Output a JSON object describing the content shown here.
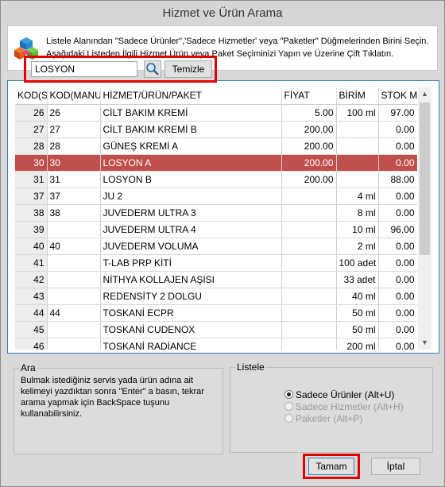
{
  "window": {
    "title": "Hizmet ve Ürün Arama"
  },
  "header": {
    "line1": "Listele Alanından \"Sadece Ürünler\",'Sadece Hizmetler' veya \"Paketler\" Düğmelerinden Birini Seçin.",
    "line2": "Aşağıdaki Listeden İlgili Hizmet,Ürün veya Paket Seçiminizi Yapın ve Üzerine Çift Tıklatın."
  },
  "grid": {
    "columns": [
      "KOD(S",
      "KOD(MANUE",
      "HİZMET/ÜRÜN/PAKET",
      "FİYAT",
      "BİRİM",
      "STOK Mİ"
    ],
    "rows": [
      [
        "26",
        "26",
        "CİLT BAKIM KREMİ",
        "5.00",
        "100 ml",
        "97.00"
      ],
      [
        "27",
        "27",
        "CİLT BAKIM KREMİ B",
        "200.00",
        "",
        "0.00"
      ],
      [
        "28",
        "28",
        "GÜNEŞ KREMİ A",
        "200.00",
        "",
        "0.00"
      ],
      [
        "30",
        "30",
        "LOSYON A",
        "200.00",
        "",
        "0.00"
      ],
      [
        "31",
        "31",
        "LOSYON B",
        "200.00",
        "",
        "88.00"
      ],
      [
        "37",
        "37",
        "JU 2",
        "",
        "4 ml",
        "0.00"
      ],
      [
        "38",
        "38",
        "JUVEDERM ULTRA 3",
        "",
        "8 ml",
        "0.00"
      ],
      [
        "39",
        "",
        "JUVEDERM ULTRA 4",
        "",
        "10 ml",
        "96.00"
      ],
      [
        "40",
        "40",
        "JUVEDERM VOLUMA",
        "",
        "2 ml",
        "0.00"
      ],
      [
        "41",
        "",
        "T-LAB PRP KİTİ",
        "",
        "100 adet",
        "0.00"
      ],
      [
        "42",
        "",
        "NİTHYA KOLLAJEN AŞISI",
        "",
        "33 adet",
        "0.00"
      ],
      [
        "43",
        "",
        "REDENSİTY 2 DOLGU",
        "",
        "40 ml",
        "0.00"
      ],
      [
        "44",
        "44",
        "TOSKANİ ECPR",
        "",
        "50 ml",
        "0.00"
      ],
      [
        "45",
        "",
        "TOSKANİ CUDENOX",
        "",
        "50 ml",
        "0.00"
      ],
      [
        "46",
        "",
        "TOSKANİ RADİANCE",
        "",
        "200 ml",
        "0.00"
      ]
    ],
    "selected_row": 3
  },
  "search": {
    "legend": "Ara",
    "hint": "Bulmak istediğiniz servis yada ürün adına ait kelimeyi yazdıktan sonra \"Enter\" a basın, tekrar arama yapmak için BackSpace tuşunu kullanabilirsiniz.",
    "value": "LOSYON",
    "clear_label": "Temizle"
  },
  "filter": {
    "legend": "Listele",
    "options": [
      {
        "label": "Sadece Ürünler (Alt+U)",
        "checked": true,
        "enabled": true
      },
      {
        "label": "Sadece Hizmetler (Alt+H)",
        "checked": false,
        "enabled": false
      },
      {
        "label": "Paketler (Alt+P)",
        "checked": false,
        "enabled": false
      }
    ]
  },
  "buttons": {
    "ok_label": "Tamam",
    "cancel_label": "İptal"
  },
  "colors": {
    "selection": "#c0504d",
    "highlight": "#e00000"
  }
}
